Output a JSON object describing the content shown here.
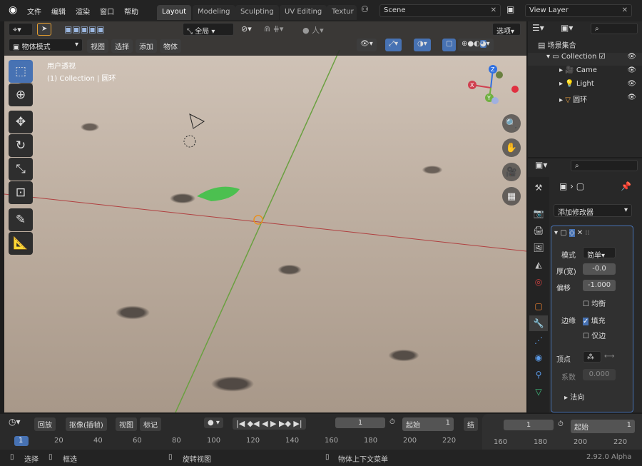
{
  "topbar": {
    "menus": [
      "文件",
      "编辑",
      "渲染",
      "窗口",
      "帮助"
    ],
    "workspace_tabs": [
      "Layout",
      "Modeling",
      "Sculpting",
      "UV Editing",
      "Textur"
    ],
    "active_tab": "Layout",
    "scene": "Scene",
    "view_layer": "View Layer"
  },
  "viewport": {
    "header": {
      "transform_orientation": "全局",
      "options_label": "选项",
      "mode": "物体模式",
      "menus": [
        "视图",
        "选择",
        "添加",
        "物体"
      ]
    },
    "overlay_text": {
      "view_name": "用户透视",
      "collection_info": "(1) Collection | 圆环"
    },
    "gizmo_axes": [
      "X",
      "Y",
      "Z"
    ],
    "tools": [
      "select-box",
      "cursor",
      "move",
      "rotate",
      "scale",
      "transform",
      "annotate",
      "measure"
    ],
    "nav_buttons": [
      "zoom",
      "pan",
      "camera",
      "perspective"
    ]
  },
  "outliner": {
    "root": "场景集合",
    "items": [
      {
        "label": "Collection",
        "icon": "collection-icon",
        "level": 1
      },
      {
        "label": "Came",
        "icon": "camera-icon",
        "level": 2
      },
      {
        "label": "Light",
        "icon": "light-icon",
        "level": 2
      },
      {
        "label": "圆环",
        "icon": "mesh-icon",
        "level": 2
      }
    ]
  },
  "properties": {
    "add_modifier_label": "添加修改器",
    "modifier": {
      "mode_label": "模式",
      "mode_value": "简单",
      "thickness_label": "厚(宽)",
      "thickness_value": "-0.0",
      "offset_label": "偏移",
      "offset_value": "-1.000",
      "even_label": "均衡",
      "rim_label": "边缘",
      "fill_label": "填充",
      "fill_checked": true,
      "only_rim_label": "仅边",
      "vertex_label": "顶点",
      "factor_label": "系数",
      "factor_value": "0.000",
      "normal_label": "法向"
    }
  },
  "timeline": {
    "menus": [
      "回放",
      "抠像(插帧)",
      "视图",
      "标记"
    ],
    "current_frame": "1",
    "start_label": "起始",
    "start_value": "1",
    "end_label": "结",
    "overlay_frame": "1",
    "overlay_start_label": "起始",
    "overlay_start_value": "1",
    "ticks": [
      "1",
      "20",
      "40",
      "60",
      "80",
      "100",
      "120",
      "140",
      "160",
      "180",
      "200",
      "220"
    ],
    "overlay_ticks": [
      "160",
      "180",
      "200",
      "220"
    ]
  },
  "statusbar": {
    "select": "选择",
    "box_select": "框选",
    "rotate_view": "旋转视图",
    "context_menu": "物体上下文菜单",
    "version": "2.92.0 Alpha"
  }
}
